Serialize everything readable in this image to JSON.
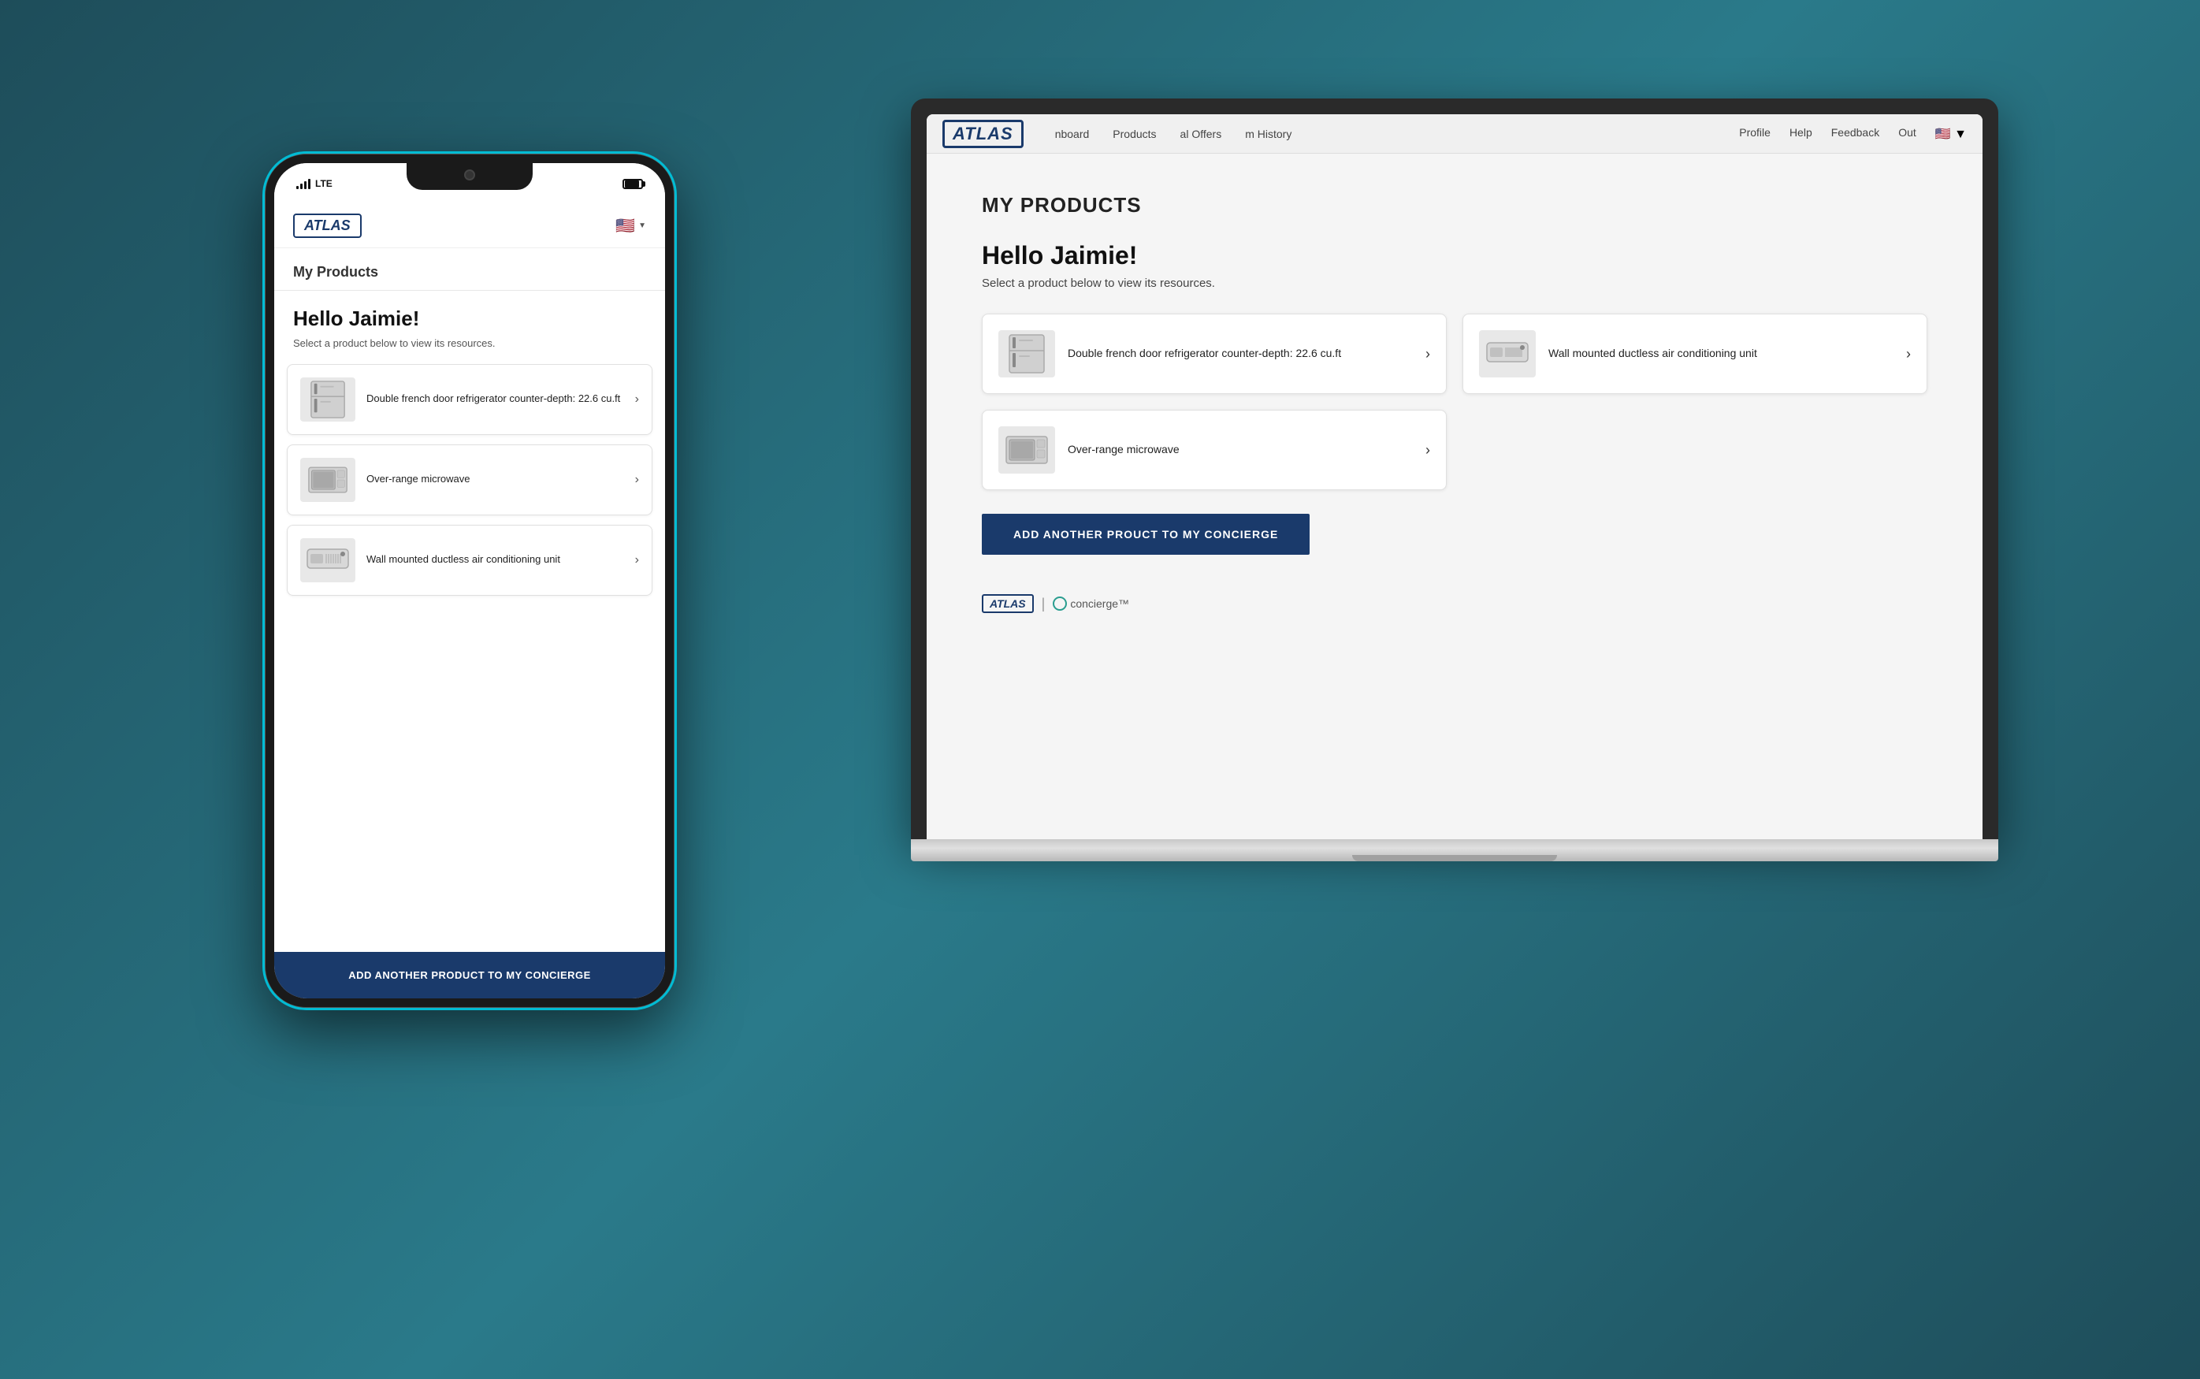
{
  "brand": {
    "logo_text": "ATLAS",
    "logo_italic": true
  },
  "phone": {
    "status_bar": {
      "signal_text": "LTE",
      "battery_label": "Battery"
    },
    "topbar": {
      "flag_emoji": "🇺🇸",
      "dropdown_arrow": "▼"
    },
    "nav": {
      "section": "My Products"
    },
    "greeting": "Hello Jaimie!",
    "subtitle": "Select a product below to view its resources.",
    "products": [
      {
        "name": "Double french door refrigerator counter-depth: 22.6 cu.ft",
        "icon": "🧊",
        "type": "fridge"
      },
      {
        "name": "Over-range microwave",
        "icon": "📦",
        "type": "microwave"
      },
      {
        "name": "Wall mounted ductless air conditioning unit",
        "icon": "❄️",
        "type": "ac"
      }
    ],
    "add_button": "ADD ANOTHER PRODUCT TO MY CONCIERGE"
  },
  "laptop": {
    "nav_items": [
      "Dashboard",
      "My Products",
      "Special Offers",
      "Claim History"
    ],
    "nav_items_partial": [
      "nboard",
      "Products",
      "al Offers",
      "m History"
    ],
    "sidebar_items": [
      "Profile",
      "Help",
      "Feedback",
      "Sign Out"
    ],
    "page_title": "MY PRODUCTS",
    "greeting": "Hello Jaimie!",
    "subtitle": "Select a product below to view its resources.",
    "products": [
      {
        "name": "Double french door refrigerator counter-depth: 22.6 cu.ft",
        "type": "fridge"
      },
      {
        "name": "Wall mounted ductless air conditioning unit",
        "type": "ac"
      },
      {
        "name": "Over-range microwave",
        "type": "microwave"
      }
    ],
    "add_button": "ADD ANOTHER PROUCT TO MY CONCIERGE",
    "footer": {
      "concierge_text": "concierge™"
    }
  },
  "colors": {
    "brand_dark": "#1a3a6b",
    "accent_cyan": "#00bcd4",
    "bg_dark": "#1e4d5a",
    "card_bg": "#ffffff",
    "page_bg": "#f5f5f5"
  }
}
